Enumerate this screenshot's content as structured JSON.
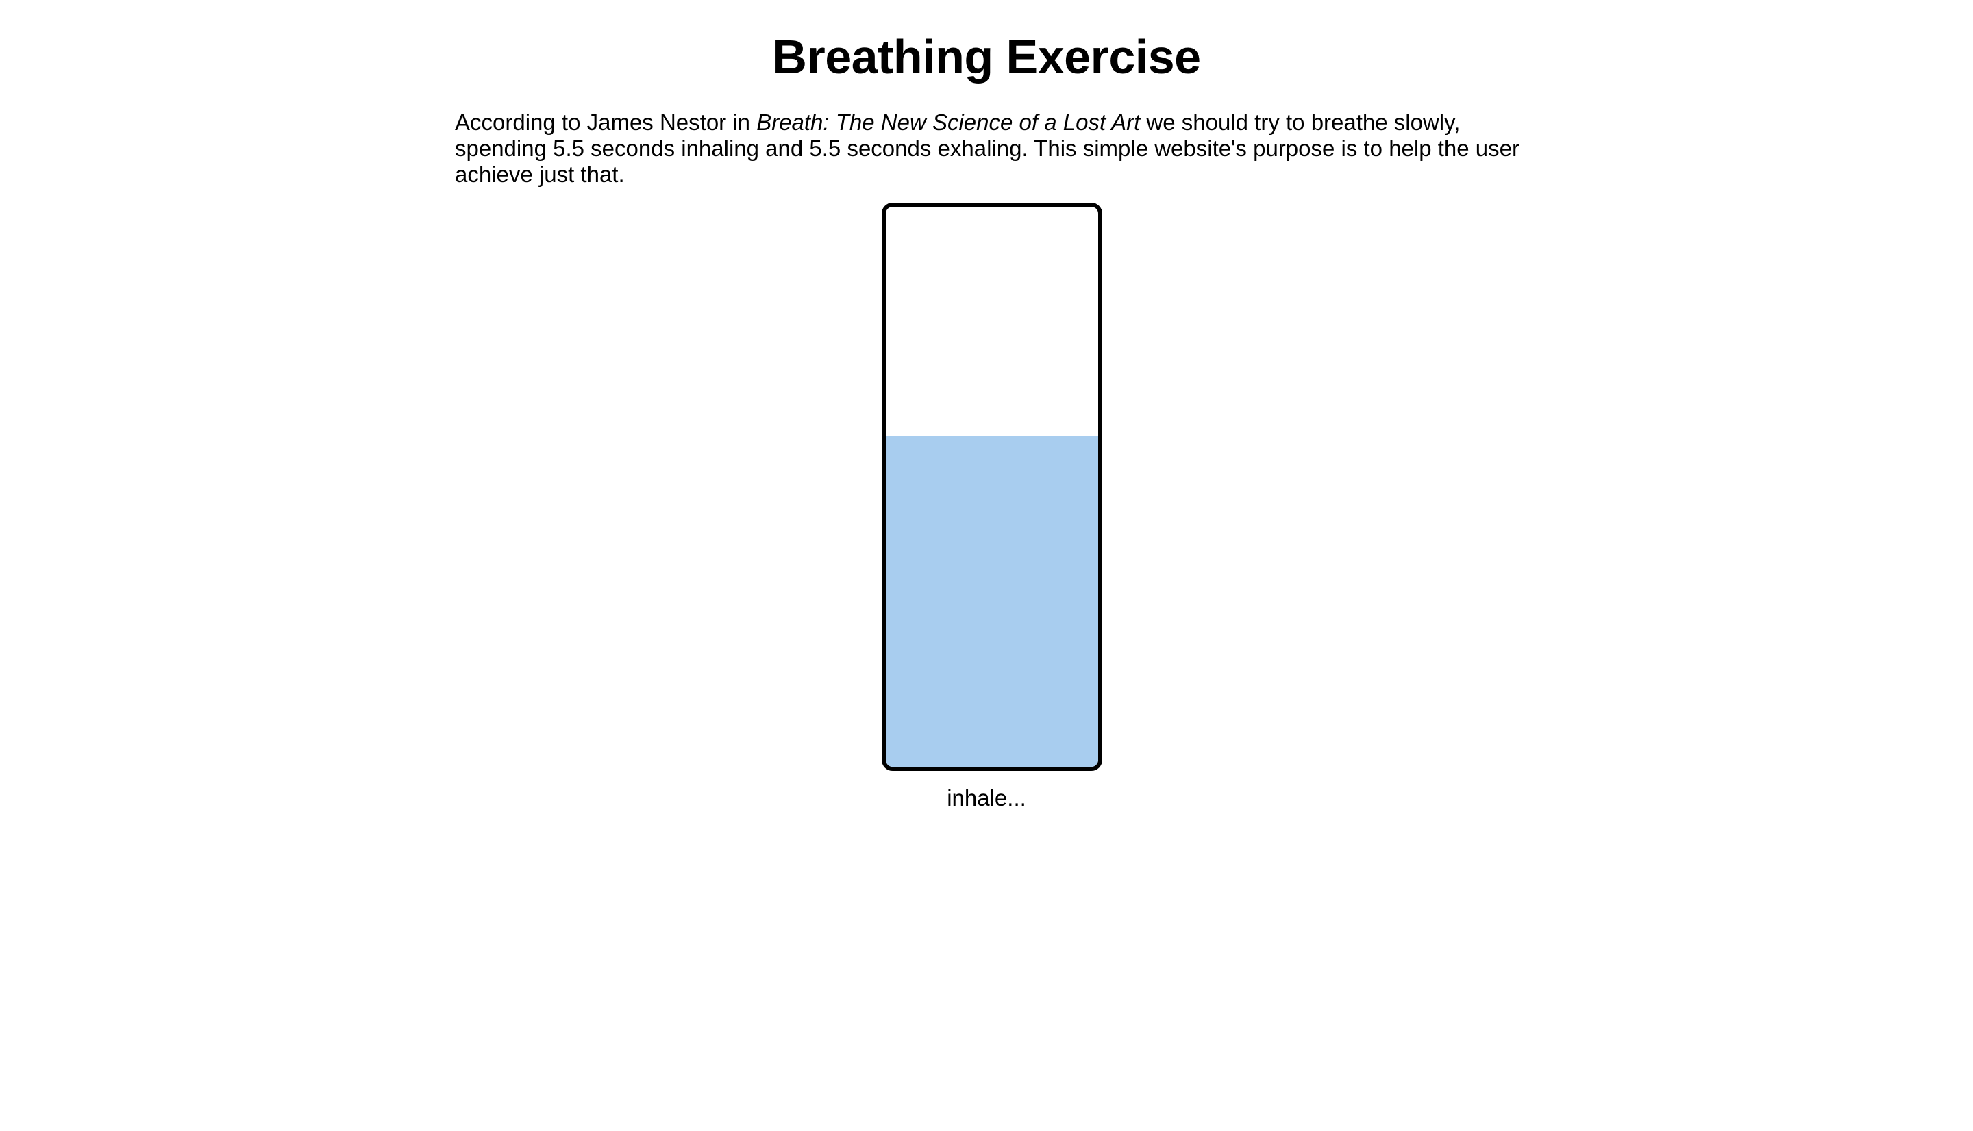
{
  "page": {
    "title": "Breathing Exercise",
    "intro": {
      "before": "According to James Nestor in ",
      "book_title": "Breath: The New Science of a Lost Art",
      "after": " we should try to breathe slowly, spending 5.5 seconds inhaling and 5.5 seconds exhaling. This simple website's purpose is to help the user achieve just that."
    }
  },
  "breath_meter": {
    "fill_fraction": 0.59,
    "fill_color": "#a8cdef",
    "border_color": "#000000",
    "status_text": "inhale..."
  }
}
